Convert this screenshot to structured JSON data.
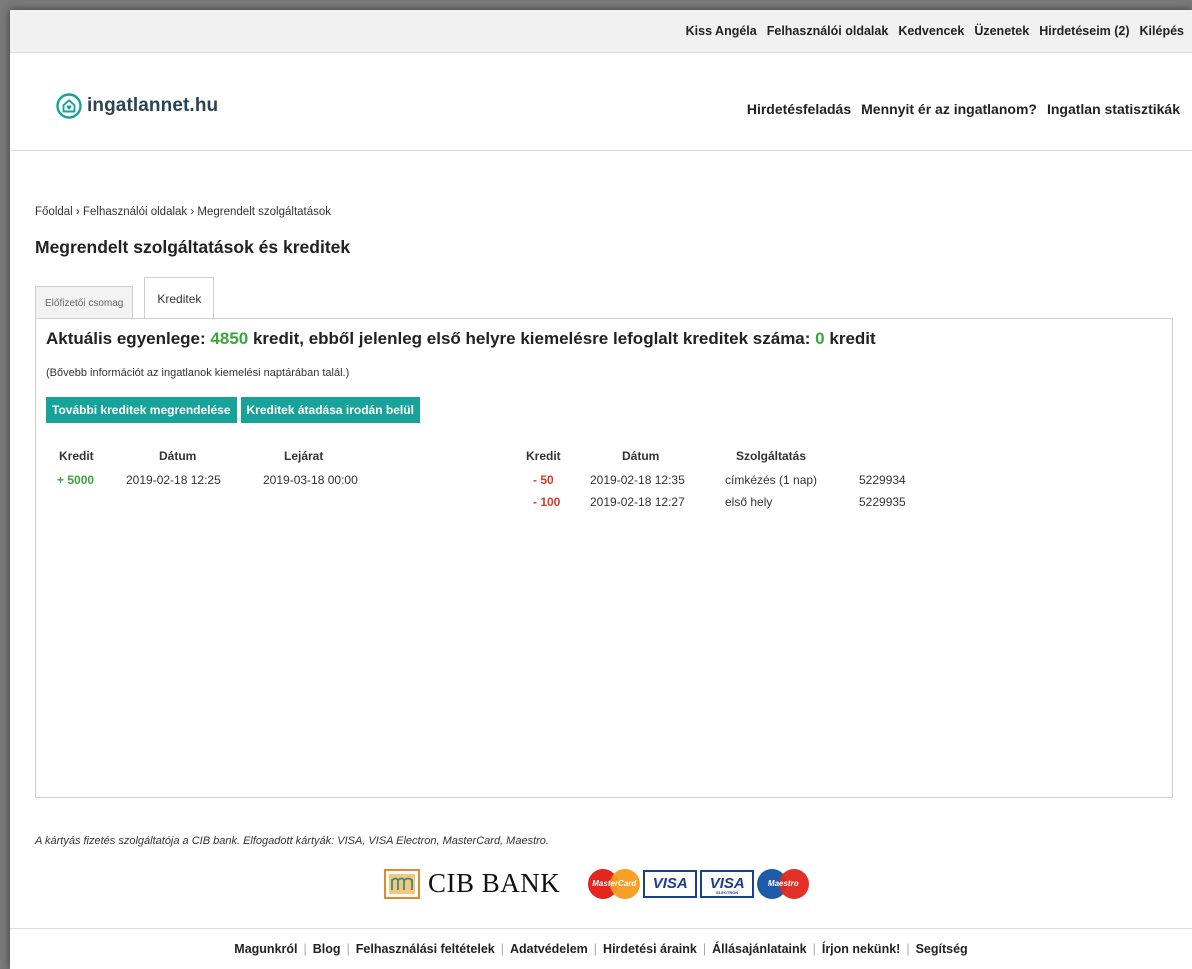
{
  "topbar": {
    "user": "Kiss Angéla",
    "links": [
      "Felhasználói oldalak",
      "Kedvencek",
      "Üzenetek",
      "Hirdetéseim (2)",
      "Kilépés"
    ]
  },
  "logo": {
    "text": "ingatlannet.hu",
    "icon": "house-heart-icon",
    "color": "#17a39a"
  },
  "mainnav": [
    "Hirdetésfeladás",
    "Mennyit ér az ingatlanom?",
    "Ingatlan statisztikák"
  ],
  "breadcrumb": {
    "home": "Főoldal",
    "sep": "›",
    "user_pages": "Felhasználói oldalak",
    "current": "Megrendelt szolgáltatások"
  },
  "page_title": "Megrendelt szolgáltatások és kreditek",
  "tabs": {
    "subscription": "Előfizetői csomag",
    "credits": "Kreditek",
    "active": "credits"
  },
  "balance": {
    "prefix": "Aktuális egyenlege:",
    "amount": "4850",
    "middle": "kredit, ebből jelenleg első helyre kiemelésre lefoglalt kreditek száma:",
    "reserved": "0",
    "suffix": "kredit"
  },
  "info_note": "(Bővebb információt az ingatlanok kiemelési naptárában talál.)",
  "buttons": {
    "order_more": "További kreditek megrendelése",
    "transfer": "Kreditek átadása irodán belül"
  },
  "credits_in": {
    "headers": {
      "credit": "Kredit",
      "date": "Dátum",
      "expiry": "Lejárat"
    },
    "rows": [
      {
        "credit": "+ 5000",
        "date": "2019-02-18 12:25",
        "expiry": "2019-03-18 00:00"
      }
    ]
  },
  "credits_out": {
    "headers": {
      "credit": "Kredit",
      "date": "Dátum",
      "service": "Szolgáltatás"
    },
    "rows": [
      {
        "credit": "- 50",
        "date": "2019-02-18 12:35",
        "service": "címkézés (1 nap)",
        "id": "5229934"
      },
      {
        "credit": "- 100",
        "date": "2019-02-18 12:27",
        "service": "első hely",
        "id": "5229935"
      }
    ]
  },
  "payment_note": "A kártyás fizetés szolgáltatója a CIB bank. Elfogadott kártyák: VISA, VISA Electron, MasterCard, Maestro.",
  "bank": {
    "name": "CIB BANK",
    "cards": {
      "mastercard": "MasterCard",
      "visa": "VISA",
      "visa_electron": "VISA",
      "electron_sub": "ELECTRON",
      "maestro": "Maestro"
    }
  },
  "footer": [
    "Magunkról",
    "Blog",
    "Felhasználási feltételek",
    "Adatvédelem",
    "Hirdetési áraink",
    "Állásajánlataink",
    "Írjon nekünk!",
    "Segítség"
  ],
  "colors": {
    "accent": "#17a39a",
    "positive": "#3aa63a",
    "negative": "#d23b2a"
  }
}
